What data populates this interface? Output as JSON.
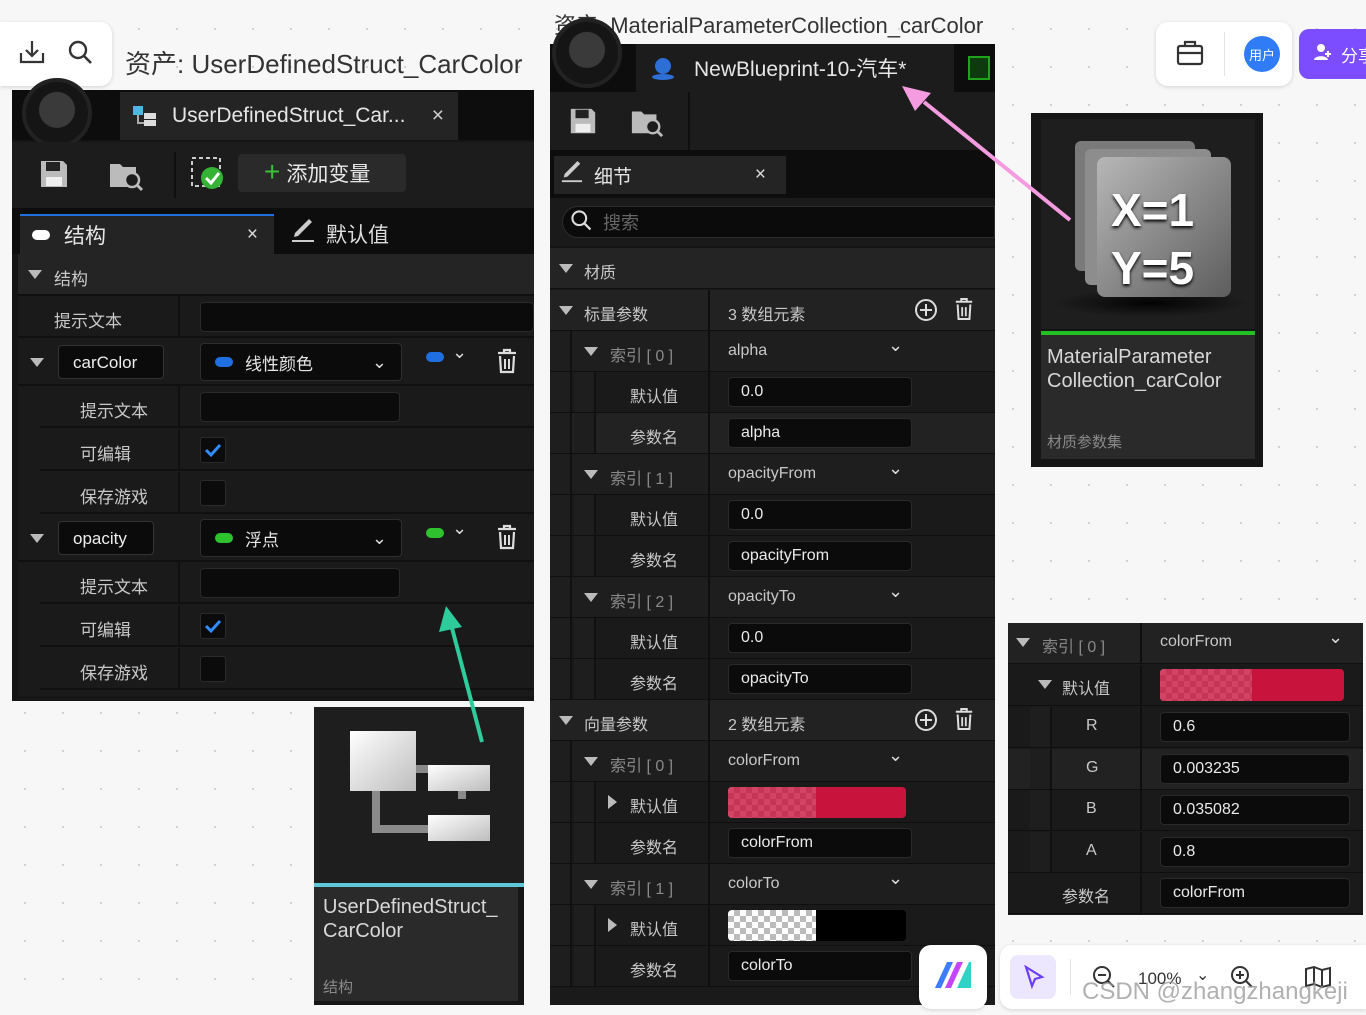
{
  "top_left_toolbar": {
    "import_icon": "tray-download-icon",
    "search_icon": "search-icon"
  },
  "struct_window": {
    "caption": "资产: UserDefinedStruct_CarColor",
    "tab_title": "UserDefinedStruct_Car...",
    "tab_close": "×",
    "add_variable_label": "添加变量",
    "tabs": [
      {
        "label": "结构",
        "close": "×"
      },
      {
        "label": "默认值"
      }
    ],
    "section_title": "结构",
    "struct_tooltip_label": "提示文本",
    "variables": [
      {
        "name": "carColor",
        "type": "线性颜色",
        "type_color": "#1f6fe0",
        "props": {
          "tooltip": "提示文本",
          "editable": "可编辑",
          "savegame": "保存游戏"
        },
        "editable_checked": true,
        "savegame_checked": false
      },
      {
        "name": "opacity",
        "type": "浮点",
        "type_color": "#2fc22f",
        "props": {
          "tooltip": "提示文本",
          "editable": "可编辑",
          "savegame": "保存游戏"
        },
        "editable_checked": true,
        "savegame_checked": false
      }
    ],
    "card": {
      "title": "UserDefinedStruct_\nCarColor",
      "subtitle": "结构",
      "accent": "#5ec8d8"
    }
  },
  "mpc_window": {
    "caption": "资产: MaterialParameterCollection_carColor",
    "tab_title": "NewBlueprint-10-汽车*",
    "details_tab": "细节",
    "details_close": "×",
    "search_placeholder": "搜索",
    "section_material": "材质",
    "scalar": {
      "label": "标量参数",
      "count": "3 数组元素",
      "items": [
        {
          "index": "索引 [ 0 ]",
          "name": "alpha",
          "default_label": "默认值",
          "default": "0.0",
          "param_label": "参数名",
          "param": "alpha"
        },
        {
          "index": "索引 [ 1 ]",
          "name": "opacityFrom",
          "default_label": "默认值",
          "default": "0.0",
          "param_label": "参数名",
          "param": "opacityFrom"
        },
        {
          "index": "索引 [ 2 ]",
          "name": "opacityTo",
          "default_label": "默认值",
          "default": "0.0",
          "param_label": "参数名",
          "param": "opacityTo"
        }
      ]
    },
    "vector": {
      "label": "向量参数",
      "count": "2 数组元素",
      "items": [
        {
          "index": "索引 [ 0 ]",
          "name": "colorFrom",
          "default_label": "默认值",
          "param_label": "参数名",
          "param": "colorFrom",
          "swatch": "#c8143c"
        },
        {
          "index": "索引 [ 1 ]",
          "name": "colorTo",
          "default_label": "默认值",
          "param_label": "参数名",
          "param": "colorTo",
          "swatch": "#000000"
        }
      ]
    },
    "card": {
      "title": "MaterialParameter\nCollection_carColor",
      "subtitle": "材质参数集",
      "icon_text_1": "X=1",
      "icon_text_2": "Y=5",
      "accent": "#22c022"
    }
  },
  "color_detail": {
    "index": "索引 [ 0 ]",
    "name": "colorFrom",
    "default_label": "默认值",
    "channels": [
      {
        "label": "R",
        "value": "0.6"
      },
      {
        "label": "G",
        "value": "0.003235"
      },
      {
        "label": "B",
        "value": "0.035082"
      },
      {
        "label": "A",
        "value": "0.8"
      }
    ],
    "param_label": "参数名",
    "param": "colorFrom",
    "swatch": "#c8143c"
  },
  "top_right": {
    "user_badge": "用户",
    "share_label": "分享",
    "accent": "#7b4dff"
  },
  "bottom_bar": {
    "zoom": "100%",
    "watermark": "CSDN @zhangzhangkeji"
  },
  "annotations": {
    "green_arrow": "#2ecc9a",
    "pink_arrow": "#f59be0"
  }
}
